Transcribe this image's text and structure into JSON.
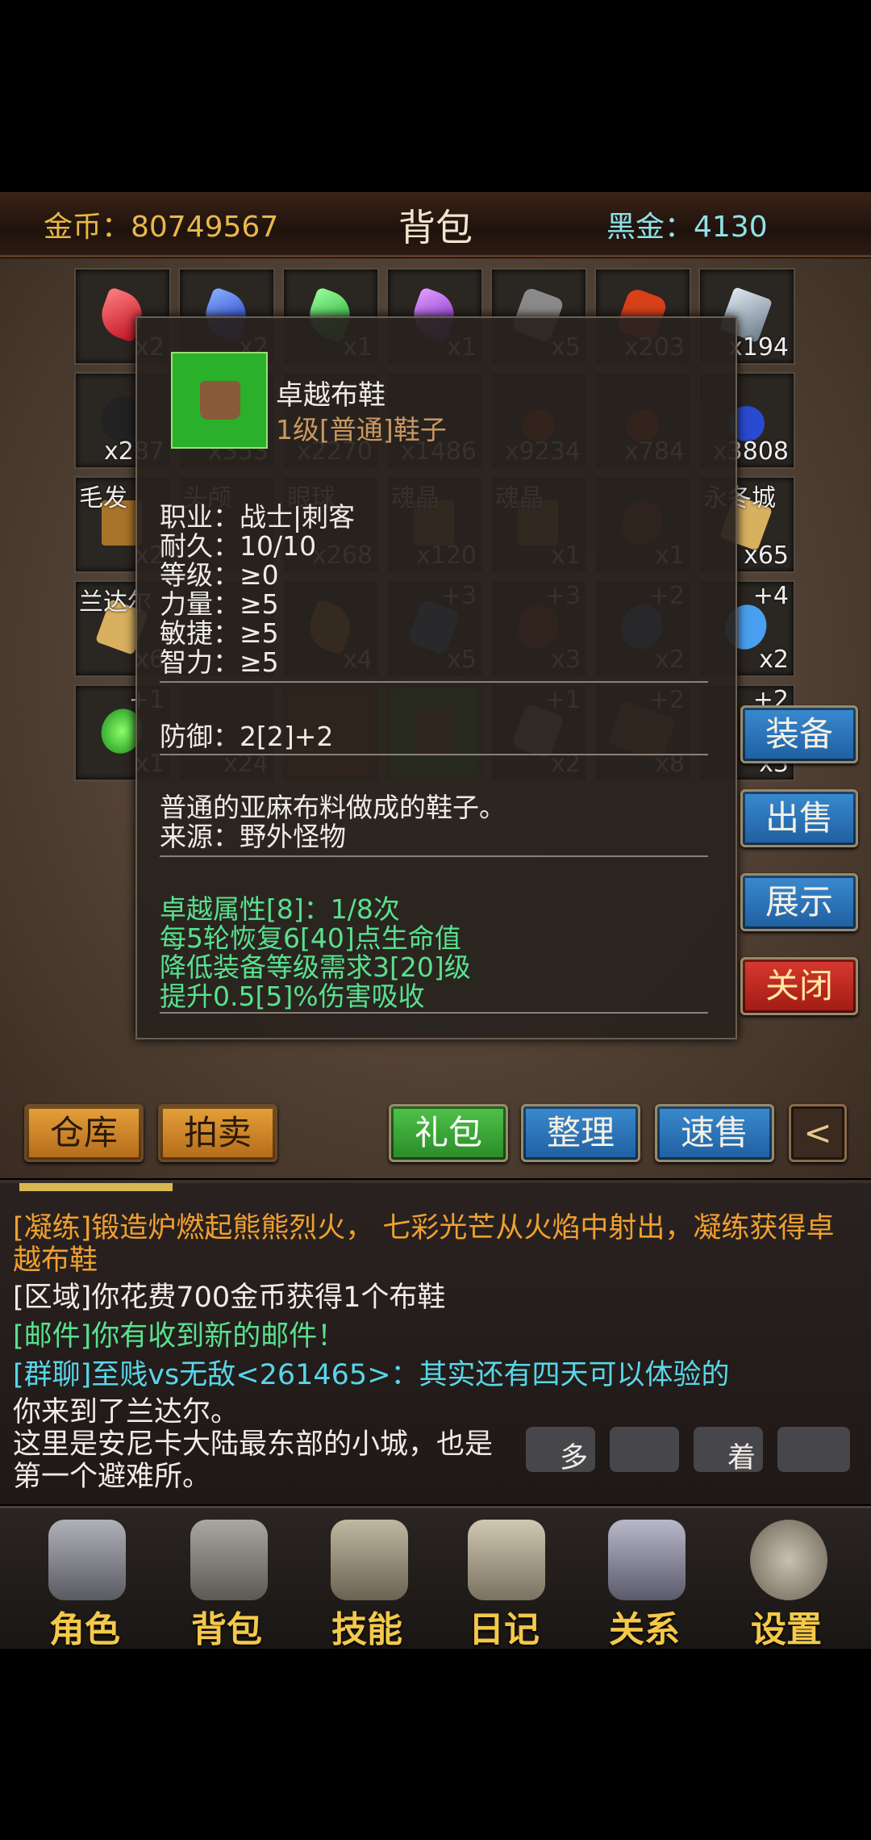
{
  "header": {
    "gold_label": "金币：80749567",
    "title": "背包",
    "black_gold_label": "黑金：4130"
  },
  "grid": {
    "row1": [
      "x2",
      "x2",
      "x1",
      "x1",
      "x5",
      "x203",
      "x194"
    ],
    "row2": [
      "x287",
      "x353",
      "x2270",
      "x1486",
      "x9234",
      "x784",
      "x3808"
    ],
    "row3_names": [
      "毛发",
      "头颅",
      "眼球",
      "魂晶",
      "魂晶",
      "",
      "永冬城"
    ],
    "row3_counts": [
      "x2",
      "",
      "x268",
      "x120",
      "x1",
      "x1",
      "x65"
    ],
    "row4_names": [
      "兰达尔",
      "",
      "",
      "",
      "",
      "",
      ""
    ],
    "row4_plus": [
      "",
      "",
      "",
      "+3",
      "+3",
      "+2",
      "+4"
    ],
    "row4_counts": [
      "x6",
      "",
      "x4",
      "x5",
      "x3",
      "x2",
      "x2"
    ],
    "row5_plus": [
      "+1",
      "",
      "",
      "",
      "+1",
      "+2",
      "+2"
    ],
    "row5_counts": [
      "x1",
      "x24",
      "",
      "",
      "x2",
      "x8",
      "x3"
    ]
  },
  "tooltip": {
    "name": "卓越布鞋",
    "subtitle": "1级[普通]鞋子",
    "req1": "职业：战士|刺客",
    "req2": "耐久：10/10",
    "req3": "等级：≥0",
    "req4": "力量：≥5",
    "req5": "敏捷：≥5",
    "req6": "智力：≥5",
    "defense": "防御：2[2]+2",
    "desc1": "普通的亚麻布料做成的鞋子。",
    "desc2": "来源：野外怪物",
    "ex1": "卓越属性[8]：1/8次",
    "ex2": "每5轮恢复6[40]点生命值",
    "ex3": "降低装备等级需求3[20]级",
    "ex4": "提升0.5[5]%伤害吸收"
  },
  "side_buttons": {
    "equip": "装备",
    "sell": "出售",
    "show": "展示",
    "close": "关闭"
  },
  "toolbar": {
    "warehouse": "仓库",
    "auction": "拍卖",
    "gift": "礼包",
    "sort": "整理",
    "quick_sell": "速售",
    "back": "<"
  },
  "chat": {
    "l1": "[凝练]锻造炉燃起熊熊烈火， 七彩光芒从火焰中射出，凝练获得卓越布鞋",
    "l2": "[区域]你花费700金币获得1个布鞋",
    "l3": "[邮件]你有收到新的邮件！",
    "l4": "[群聊]至贱vs无敌<261465>：其实还有四天可以体验的",
    "l5": "你来到了兰达尔。",
    "l6": "这里是安尼卡大陆最东部的小城，也是",
    "l6b": "多",
    "l6c": "着",
    "l7": "第一个避难所。"
  },
  "nav": {
    "role": "角色",
    "bag": "背包",
    "skill": "技能",
    "diary": "日记",
    "relation": "关系",
    "settings": "设置"
  },
  "colors": {
    "gold": "#e7b84a",
    "black_gold": "#8fe2e6",
    "excellent": "#58e18e",
    "forge": "#f0a030",
    "mail": "#58e18e",
    "group": "#58d6e8",
    "nav_label": "#f4c84a"
  }
}
